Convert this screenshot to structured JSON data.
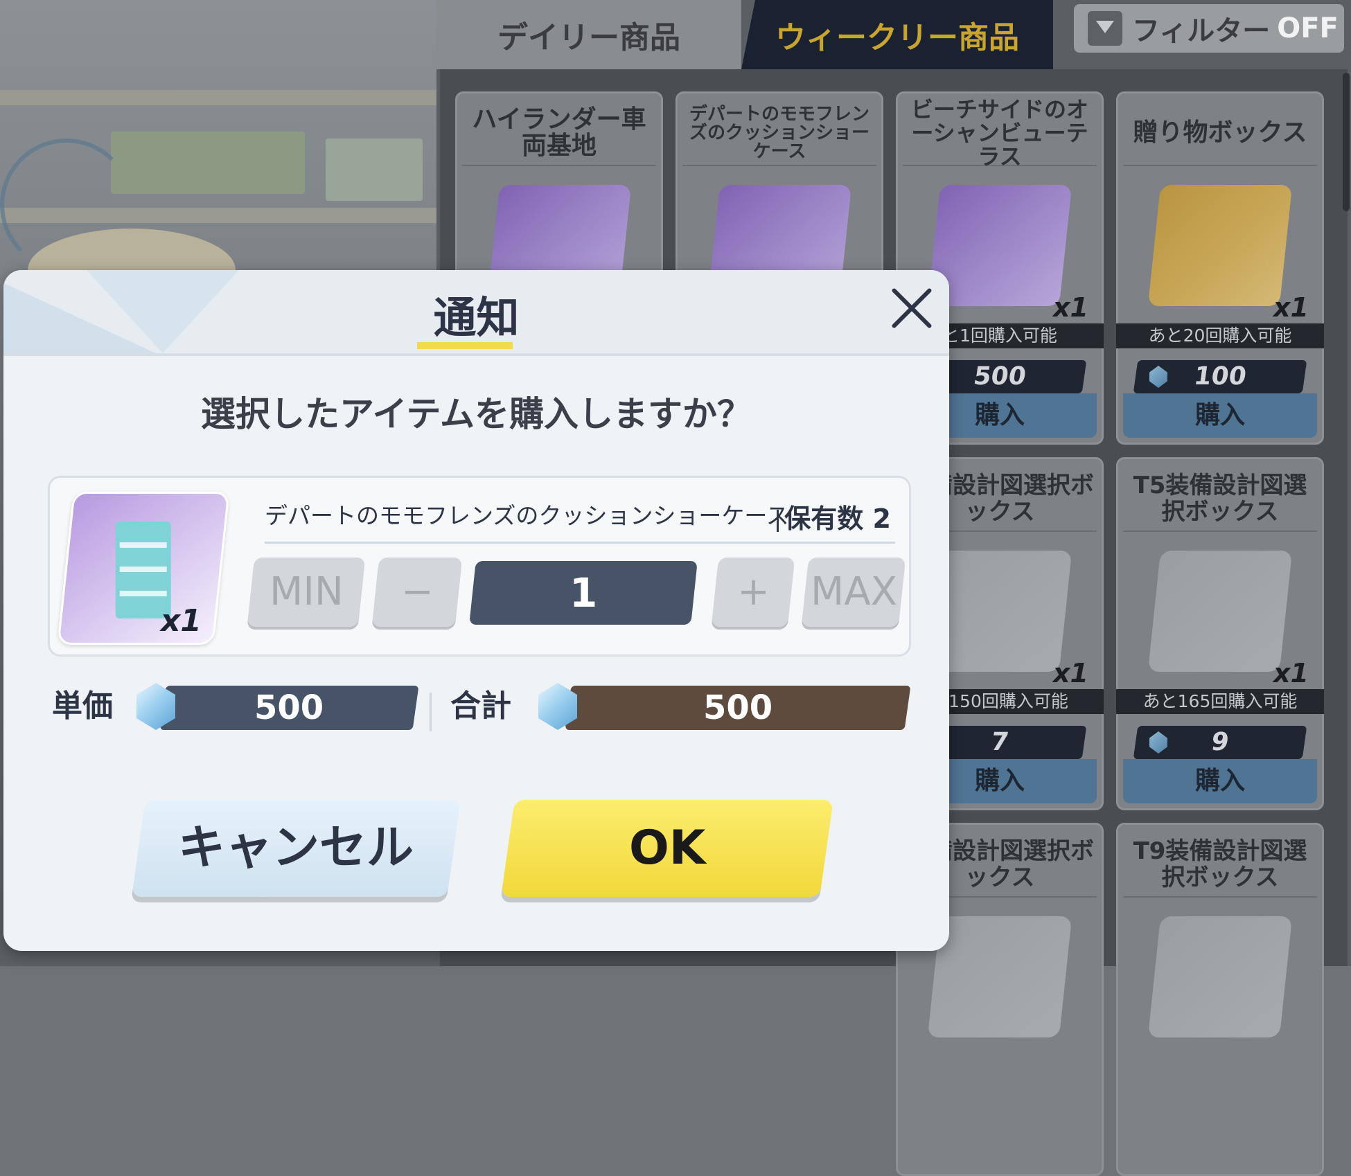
{
  "shop": {
    "tabs": [
      {
        "label": "デイリー商品",
        "active": false
      },
      {
        "label": "ウィークリー商品",
        "active": true
      }
    ],
    "filter": {
      "label": "フィルター",
      "state": "OFF"
    },
    "cards": [
      {
        "title": "ハイランダー車両基地",
        "image": "purple"
      },
      {
        "title": "デパートのモモフレンズのクッションショーケース",
        "image": "purple"
      },
      {
        "title": "ビーチサイドのオーシャンビューテラス",
        "image": "purple",
        "qty": "x1",
        "remain": "と1回購入可能",
        "price": "500",
        "buy": "購入"
      },
      {
        "title": "贈り物ボックス",
        "image": "gold",
        "qty": "x1",
        "remain": "あと20回購入可能",
        "price": "100",
        "buy": "購入"
      },
      {
        "title": "装備設計図選択ボックス",
        "image": "gray",
        "qty": "x1",
        "remain": "と150回購入可能",
        "price": "7",
        "buy": "購入"
      },
      {
        "title": "T5装備設計図選択ボックス",
        "image": "gray",
        "qty": "x1",
        "remain": "あと165回購入可能",
        "price": "9",
        "buy": "購入"
      },
      {
        "title": "装備設計図選択ボックス",
        "image": "gray"
      },
      {
        "title": "T9装備設計図選択ボックス",
        "image": "gray"
      }
    ]
  },
  "modal": {
    "title": "通知",
    "question": "選択したアイテムを購入しますか？",
    "item": {
      "name": "デパートのモモフレンズのクッションショーケース",
      "qty": "x1",
      "owned_label": "保有数",
      "owned_count": "2"
    },
    "quantity": {
      "min_label": "MIN",
      "minus_label": "−",
      "value": "1",
      "plus_label": "+",
      "max_label": "MAX"
    },
    "unit_price": {
      "label": "単価",
      "value": "500"
    },
    "total": {
      "label": "合計",
      "value": "500"
    },
    "cancel_label": "キャンセル",
    "ok_label": "OK",
    "icons": {
      "close": "close-icon",
      "currency": "diamond-gem-icon"
    }
  }
}
